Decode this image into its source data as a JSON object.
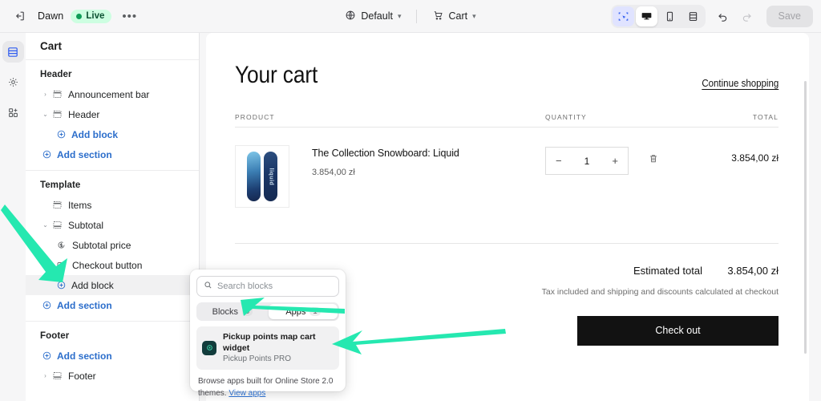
{
  "topbar": {
    "exit_icon": "exit-icon",
    "theme_name": "Dawn",
    "status_label": "Live",
    "more_label": "•••",
    "page_selector": {
      "icon": "globe-icon",
      "label": "Default"
    },
    "template_selector": {
      "icon": "cart-icon",
      "label": "Cart"
    },
    "view_modes": [
      {
        "name": "inspector-icon",
        "active": true,
        "style": "blue"
      },
      {
        "name": "desktop-icon",
        "active": true,
        "style": "white"
      },
      {
        "name": "mobile-icon",
        "active": false,
        "style": ""
      },
      {
        "name": "fullscreen-icon",
        "active": false,
        "style": ""
      }
    ],
    "undo_label": "↶",
    "redo_label": "↷",
    "save_label": "Save"
  },
  "rail": [
    {
      "name": "sections-icon",
      "active": true
    },
    {
      "name": "settings-gear-icon",
      "active": false
    },
    {
      "name": "apps-grid-icon",
      "active": false
    }
  ],
  "sidebar": {
    "title": "Cart",
    "groups": [
      {
        "title": "Header",
        "rows": [
          {
            "label": "Announcement bar",
            "icon": "section-icon",
            "caret": "›",
            "indent": 1,
            "type": "section"
          },
          {
            "label": "Header",
            "icon": "section-icon",
            "caret": "⌄",
            "indent": 1,
            "type": "section"
          },
          {
            "label": "Add block",
            "icon": "plus-circle-icon",
            "indent": 2,
            "type": "link"
          },
          {
            "label": "Add section",
            "icon": "plus-circle-icon",
            "indent": 1,
            "type": "link"
          }
        ]
      },
      {
        "title": "Template",
        "rows": [
          {
            "label": "Items",
            "icon": "section-icon",
            "indent": 1,
            "type": "section"
          },
          {
            "label": "Subtotal",
            "icon": "block-icon",
            "caret": "⌄",
            "indent": 1,
            "type": "section"
          },
          {
            "label": "Subtotal price",
            "icon": "price-icon",
            "indent": 2,
            "type": "block"
          },
          {
            "label": "Checkout button",
            "icon": "button-icon",
            "indent": 2,
            "type": "block"
          },
          {
            "label": "Add block",
            "icon": "plus-circle-icon",
            "indent": 2,
            "type": "addblock",
            "hovered": true
          },
          {
            "label": "Add section",
            "icon": "plus-circle-icon",
            "indent": 1,
            "type": "link"
          }
        ]
      },
      {
        "title": "Footer",
        "rows": [
          {
            "label": "Add section",
            "icon": "plus-circle-icon",
            "indent": 1,
            "type": "link"
          },
          {
            "label": "Footer",
            "icon": "block-icon",
            "caret": "›",
            "indent": 1,
            "type": "section"
          }
        ]
      }
    ]
  },
  "popover": {
    "search_placeholder": "Search blocks",
    "search_value": "",
    "search_icon": "search-icon",
    "tabs": [
      {
        "label": "Blocks",
        "count": "0",
        "active": false
      },
      {
        "label": "Apps",
        "count": "1",
        "active": true
      }
    ],
    "app": {
      "name": "Pickup points map cart widget",
      "developer": "Pickup Points PRO",
      "icon": "pickup-point-app-icon"
    },
    "footer_text": "Browse apps built for Online Store 2.0 themes. ",
    "footer_link": "View apps"
  },
  "cart": {
    "title": "Your cart",
    "continue_link": "Continue shopping",
    "columns": {
      "product": "PRODUCT",
      "quantity": "QUANTITY",
      "total": "TOTAL"
    },
    "items": [
      {
        "name": "The Collection Snowboard: Liquid",
        "price": "3.854,00 zł",
        "quantity": "1",
        "decrement": "−",
        "increment": "+",
        "remove_icon": "trash-icon",
        "line_total": "3.854,00 zł",
        "thumb_label": "liquid"
      }
    ],
    "estimated_total_label": "Estimated total",
    "estimated_total_value": "3.854,00 zł",
    "tax_note": "Tax included and shipping and discounts calculated at checkout",
    "checkout_label": "Check out"
  },
  "colors": {
    "annotation_arrow": "#25e8b0",
    "accent_link": "#2c6ecb",
    "active_rail": "#2f5cf0",
    "live_badge_bg": "#cdfee1",
    "checkout_button": "#121212"
  }
}
